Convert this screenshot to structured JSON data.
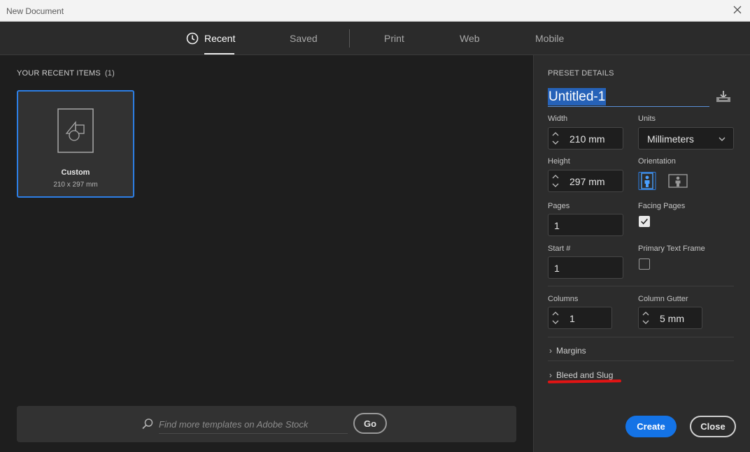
{
  "window": {
    "title": "New Document"
  },
  "tabs": [
    {
      "label": "Recent",
      "active": true
    },
    {
      "label": "Saved"
    },
    {
      "label": "Print"
    },
    {
      "label": "Web"
    },
    {
      "label": "Mobile"
    }
  ],
  "recent": {
    "heading": "YOUR RECENT ITEMS",
    "count": "(1)",
    "items": [
      {
        "name": "Custom",
        "size": "210 x 297 mm"
      }
    ]
  },
  "search": {
    "placeholder": "Find more templates on Adobe Stock",
    "go_label": "Go"
  },
  "preset": {
    "heading": "PRESET DETAILS",
    "doc_name": "Untitled-1",
    "width_label": "Width",
    "width_value": "210 mm",
    "units_label": "Units",
    "units_value": "Millimeters",
    "height_label": "Height",
    "height_value": "297 mm",
    "orientation_label": "Orientation",
    "orientation_selected": "portrait",
    "pages_label": "Pages",
    "pages_value": "1",
    "facing_label": "Facing Pages",
    "facing_checked": true,
    "start_label": "Start #",
    "start_value": "1",
    "ptf_label": "Primary Text Frame",
    "ptf_checked": false,
    "columns_label": "Columns",
    "columns_value": "1",
    "gutter_label": "Column Gutter",
    "gutter_value": "5 mm",
    "margins_label": "Margins",
    "bleed_label": "Bleed and Slug"
  },
  "actions": {
    "create_label": "Create",
    "close_label": "Close"
  },
  "colors": {
    "accent": "#1473e6",
    "selection": "#2662b8",
    "highlight_underline": "#e21414"
  }
}
